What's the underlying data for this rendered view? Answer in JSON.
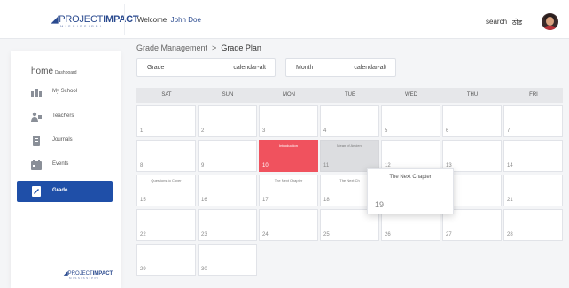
{
  "header": {
    "logo_main": "PROJECT",
    "logo_bold": "IMPACT",
    "logo_sub": "MISSISSIPPI",
    "welcome_label": "Welcome,",
    "user_name": "John Doe",
    "search_label": "search",
    "lang_label": "ठोड"
  },
  "sidebar": {
    "title_home": "home",
    "title_dashboard": "Dashboard",
    "items": [
      {
        "label": "My School",
        "icon": "school-icon",
        "active": false
      },
      {
        "label": "Teachers",
        "icon": "teacher-icon",
        "active": false
      },
      {
        "label": "Journals",
        "icon": "journal-icon",
        "active": false
      },
      {
        "label": "Events",
        "icon": "events-icon",
        "active": false
      },
      {
        "label": "Grade",
        "icon": "grade-icon",
        "active": true
      }
    ],
    "footer_logo_main": "PROJECT",
    "footer_logo_bold": "IMPACT",
    "footer_logo_sub": "MISSISSIPPI"
  },
  "breadcrumb": {
    "parent": "Grade Management",
    "separator": ">",
    "current": "Grade Plan"
  },
  "filters": {
    "grade_label": "Grade",
    "grade_icon_text": "calendar-alt",
    "month_label": "Month",
    "month_icon_text": "calendar-alt"
  },
  "calendar": {
    "days": [
      "SAT",
      "SUN",
      "MON",
      "TUE",
      "WED",
      "THU",
      "FRI"
    ],
    "weeks": [
      [
        {
          "n": "1"
        },
        {
          "n": "2"
        },
        {
          "n": "3"
        },
        {
          "n": "4"
        },
        {
          "n": "5"
        },
        {
          "n": "6"
        },
        {
          "n": "7"
        }
      ],
      [
        {
          "n": "8"
        },
        {
          "n": "9"
        },
        {
          "n": "10",
          "ev": "Introduction",
          "style": "red"
        },
        {
          "n": "11",
          "ev": "Mean of Ancient",
          "style": "grey"
        },
        {
          "n": "12"
        },
        {
          "n": "13"
        },
        {
          "n": "14"
        }
      ],
      [
        {
          "n": "15",
          "ev": "Questions to Cover"
        },
        {
          "n": "16"
        },
        {
          "n": "17",
          "ev": "The Next Chapter"
        },
        {
          "n": "18",
          "ev": "The Next Ch"
        },
        {
          "n": "19"
        },
        {
          "n": "20"
        },
        {
          "n": "21"
        }
      ],
      [
        {
          "n": "22"
        },
        {
          "n": "23"
        },
        {
          "n": "24"
        },
        {
          "n": "25"
        },
        {
          "n": "26"
        },
        {
          "n": "27"
        },
        {
          "n": "28"
        }
      ],
      [
        {
          "n": "29"
        },
        {
          "n": "30"
        }
      ]
    ],
    "popup": {
      "title": "The Next Chapter",
      "day": "19"
    },
    "colors": {
      "event_red": "#f0525e",
      "event_grey": "#dcdde0",
      "active_nav": "#1f4fa8"
    }
  }
}
